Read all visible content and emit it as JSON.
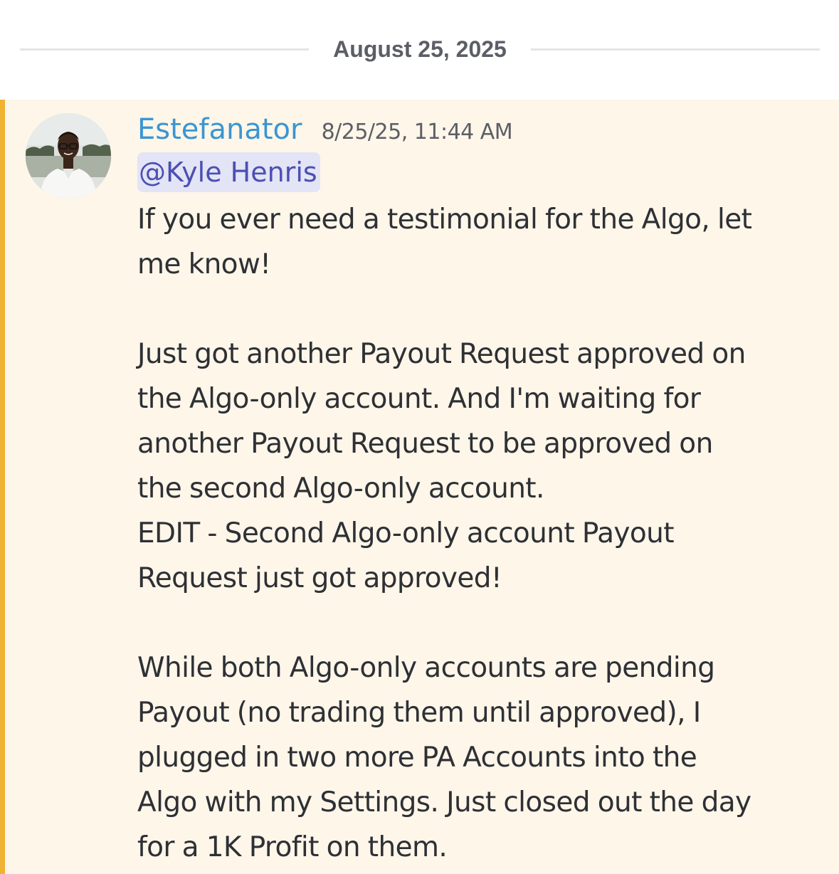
{
  "date_divider": {
    "label": "August 25, 2025"
  },
  "message": {
    "author": "Estefanator",
    "timestamp": "8/25/25, 11:44 AM",
    "mention": "@Kyle Henris",
    "avatar_icon": "user-avatar-photo",
    "accent_color": "#f0b232",
    "author_color": "#3b95d2",
    "highlight_background": "#fdf6e9",
    "body_lines": [
      "If you ever need a testimonial for the Algo, let",
      "me know!",
      "",
      "Just got another Payout Request approved on",
      "the Algo-only account. And I'm waiting for",
      "another Payout Request to be approved on",
      "the second Algo-only account.",
      "EDIT - Second Algo-only account Payout",
      "Request just got approved!",
      "",
      "While both Algo-only accounts are pending",
      "Payout (no trading them until approved), I",
      "plugged in two more PA Accounts into the",
      "Algo with my Settings. Just closed out the day",
      "for a 1K Profit on them."
    ]
  }
}
